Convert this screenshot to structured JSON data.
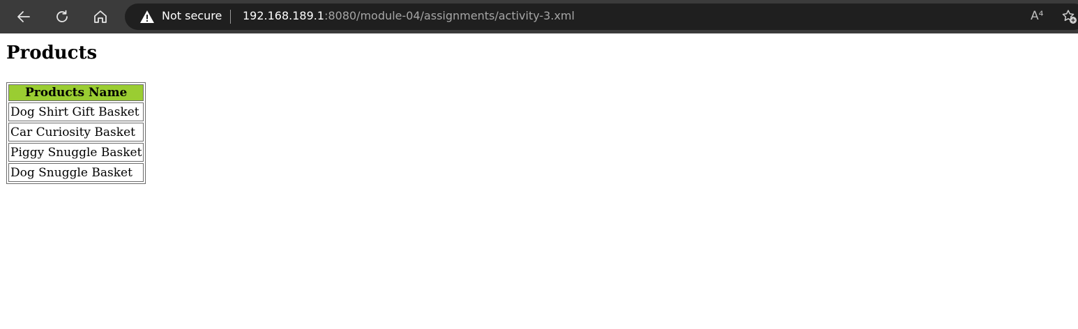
{
  "browser": {
    "security_label": "Not secure",
    "url_host": "192.168.189.1",
    "url_rest": ":8080/module-04/assignments/activity-3.xml",
    "read_aloud_glyph": "A⁴",
    "icons": [
      "back-icon",
      "refresh-icon",
      "home-icon",
      "warning-icon",
      "read-aloud-icon",
      "favorites-icon"
    ]
  },
  "page": {
    "heading": "Products",
    "table": {
      "header": "Products Name",
      "header_color": "#9acd32",
      "rows": [
        "Dog Shirt Gift Basket",
        "Car Curiosity Basket",
        "Piggy Snuggle Basket",
        "Dog Snuggle Basket"
      ]
    }
  }
}
